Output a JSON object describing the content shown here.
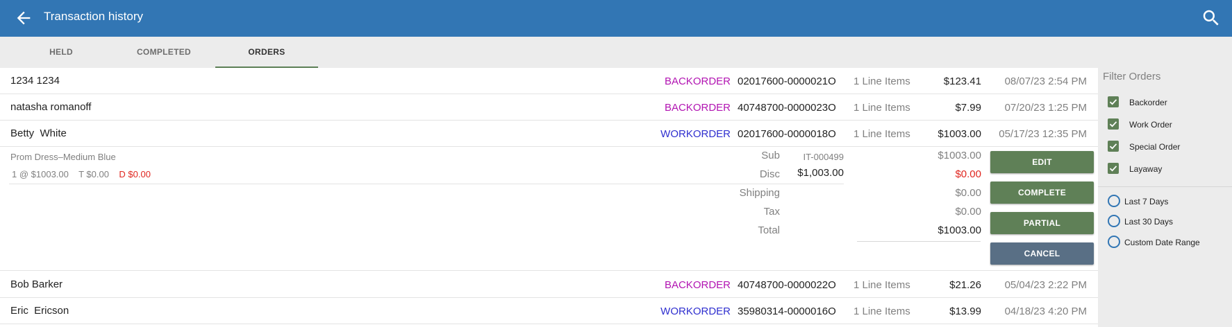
{
  "header": {
    "title": "Transaction history",
    "back_icon": "arrow-left-icon",
    "search_icon": "search-icon",
    "bar_color": "#3276b4"
  },
  "tabs": [
    {
      "label": "HELD"
    },
    {
      "label": "COMPLETED"
    },
    {
      "label": "ORDERS",
      "active": true
    }
  ],
  "orders": [
    {
      "name": "1234 1234",
      "type": "BACKORDER",
      "number": "02017600-0000021O",
      "items": "1 Line Items",
      "amount": "$123.41",
      "date": "08/07/23 2:54 PM"
    },
    {
      "name": "natasha romanoff",
      "type": "BACKORDER",
      "number": "40748700-0000023O",
      "items": "1 Line Items",
      "amount": "$7.99",
      "date": "07/20/23 1:25 PM"
    },
    {
      "name": "Betty  White",
      "type": "WORKORDER",
      "number": "02017600-0000018O",
      "items": "1 Line Items",
      "amount": "$1003.00",
      "date": "05/17/23 12:35 PM"
    },
    {
      "name": "Bob Barker",
      "type": "BACKORDER",
      "number": "40748700-0000022O",
      "items": "1 Line Items",
      "amount": "$21.26",
      "date": "05/04/23 2:22 PM"
    },
    {
      "name": "Eric  Ericson",
      "type": "WORKORDER",
      "number": "35980314-0000016O",
      "items": "1 Line Items",
      "amount": "$13.99",
      "date": "04/18/23 4:20 PM"
    }
  ],
  "detail": {
    "item_name": "Prom Dress–Medium Blue",
    "sku": "IT-000499",
    "qty_price": "1 @ $1003.00",
    "tax": "T $0.00",
    "discount": "D $0.00",
    "line_total": "$1,003.00",
    "summary": [
      {
        "label": "Sub",
        "value": "$1003.00"
      },
      {
        "label": "Disc",
        "value": "$0.00"
      },
      {
        "label": "Shipping",
        "value": "$0.00"
      },
      {
        "label": "Tax",
        "value": "$0.00"
      },
      {
        "label": "Total",
        "value": "$1003.00"
      }
    ],
    "buttons": {
      "edit": "EDIT",
      "complete": "COMPLETE",
      "partial": "PARTIAL",
      "cancel": "CANCEL"
    }
  },
  "filter": {
    "title": "Filter Orders",
    "checkboxes": [
      {
        "label": "Backorder",
        "checked": true
      },
      {
        "label": "Work Order",
        "checked": true
      },
      {
        "label": "Special Order",
        "checked": true
      },
      {
        "label": "Layaway",
        "checked": true
      }
    ],
    "radios": [
      {
        "label": "Last 7 Days",
        "selected": false
      },
      {
        "label": "Last 30 Days",
        "selected": false
      },
      {
        "label": "Custom Date Range",
        "selected": false
      }
    ]
  },
  "colors": {
    "backorder": "#b214b2",
    "workorder": "#2f2fcf",
    "button_green": "#5f8057",
    "button_slate": "#596f85",
    "discount_red": "#e0261f"
  }
}
